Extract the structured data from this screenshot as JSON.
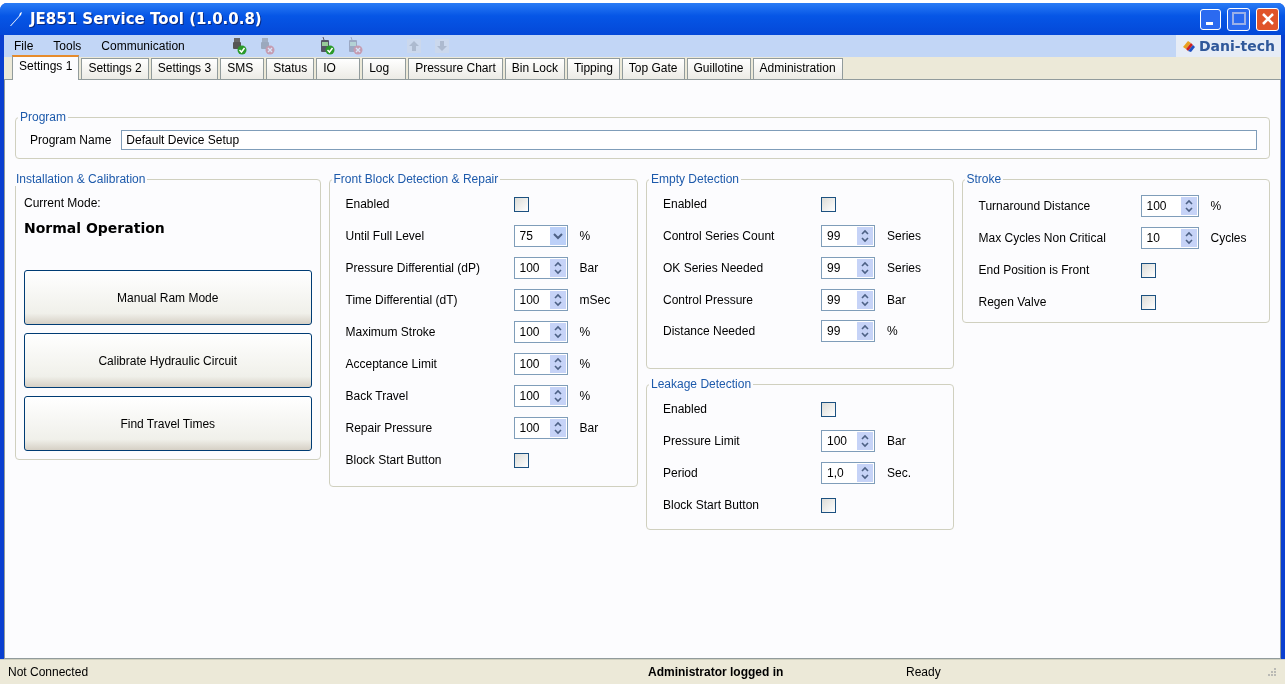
{
  "window": {
    "title": "JE851 Service Tool (1.0.0.8)"
  },
  "menu": [
    "File",
    "Tools",
    "Communication"
  ],
  "toolbar": [
    {
      "kind": "connect",
      "disabled": false
    },
    {
      "kind": "disconnect",
      "disabled": true
    },
    {
      "kind": "dial",
      "disabled": false
    },
    {
      "kind": "hangup",
      "disabled": true
    },
    {
      "kind": "upload",
      "disabled": true
    },
    {
      "kind": "download",
      "disabled": true
    }
  ],
  "logo": {
    "text": "Dani-tech"
  },
  "tabs": [
    {
      "label": "Settings 1",
      "selected": true
    },
    {
      "label": "Settings 2",
      "selected": false
    },
    {
      "label": "Settings 3",
      "selected": false
    },
    {
      "label": "SMS",
      "selected": false
    },
    {
      "label": "Status",
      "selected": false
    },
    {
      "label": "IO",
      "selected": false
    },
    {
      "label": "Log",
      "selected": false
    },
    {
      "label": "Pressure Chart",
      "selected": false
    },
    {
      "label": "Bin Lock",
      "selected": false
    },
    {
      "label": "Tipping",
      "selected": false
    },
    {
      "label": "Top Gate",
      "selected": false
    },
    {
      "label": "Guillotine",
      "selected": false
    },
    {
      "label": "Administration",
      "selected": false
    }
  ],
  "program": {
    "title": "Program",
    "label": "Program Name",
    "value": "Default Device Setup"
  },
  "installation": {
    "title": "Installation & Calibration",
    "mode_label": "Current Mode:",
    "mode_value": "Normal Operation",
    "buttons": [
      "Manual Ram Mode",
      "Calibrate Hydraulic Circuit",
      "Find Travel Times"
    ]
  },
  "groups": [
    {
      "title": "Front Block Detection & Repair",
      "rows": [
        {
          "kind": "checkbox",
          "label": "Enabled",
          "checked": false
        },
        {
          "kind": "dropdown",
          "label": "Until Full Level",
          "value": "75",
          "unit": "%"
        },
        {
          "kind": "spin",
          "label": "Pressure Differential (dP)",
          "value": "100",
          "unit": "Bar"
        },
        {
          "kind": "spin",
          "label": "Time Differential (dT)",
          "value": "100",
          "unit": "mSec"
        },
        {
          "kind": "spin",
          "label": "Maximum Stroke",
          "value": "100",
          "unit": "%"
        },
        {
          "kind": "spin",
          "label": "Acceptance Limit",
          "value": "100",
          "unit": "%"
        },
        {
          "kind": "spin",
          "label": "Back Travel",
          "value": "100",
          "unit": "%"
        },
        {
          "kind": "spin",
          "label": "Repair Pressure",
          "value": "100",
          "unit": "Bar"
        },
        {
          "kind": "checkbox",
          "label": "Block Start Button",
          "checked": false
        }
      ]
    },
    {
      "title": "Empty Detection",
      "rows": [
        {
          "kind": "checkbox",
          "label": "Enabled",
          "checked": false
        },
        {
          "kind": "spin",
          "label": "Control Series Count",
          "value": "99",
          "unit": "Series"
        },
        {
          "kind": "spin",
          "label": "OK Series Needed",
          "value": "99",
          "unit": "Series"
        },
        {
          "kind": "spin",
          "label": "Control Pressure",
          "value": "99",
          "unit": "Bar"
        },
        {
          "kind": "spin",
          "label": "Distance Needed",
          "value": "99",
          "unit": "%"
        }
      ]
    },
    {
      "title": "Leakage Detection",
      "rows": [
        {
          "kind": "checkbox",
          "label": "Enabled",
          "checked": false
        },
        {
          "kind": "spin",
          "label": "Pressure Limit",
          "value": "100",
          "unit": "Bar"
        },
        {
          "kind": "spin",
          "label": "Period",
          "value": "1,0",
          "unit": "Sec."
        },
        {
          "kind": "checkbox",
          "label": "Block Start Button",
          "checked": false
        }
      ]
    },
    {
      "title": "Stroke",
      "rows": [
        {
          "kind": "spin",
          "label": "Turnaround Distance",
          "value": "100",
          "unit": "%"
        },
        {
          "kind": "spin",
          "label": "Max Cycles Non Critical",
          "value": "10",
          "unit": "Cycles"
        },
        {
          "kind": "checkbox",
          "label": "End Position is Front",
          "checked": false
        },
        {
          "kind": "checkbox",
          "label": "Regen Valve",
          "checked": false
        }
      ]
    }
  ],
  "status_bar": {
    "connection": "Not Connected",
    "user": "Administrator logged in",
    "state": "Ready"
  }
}
